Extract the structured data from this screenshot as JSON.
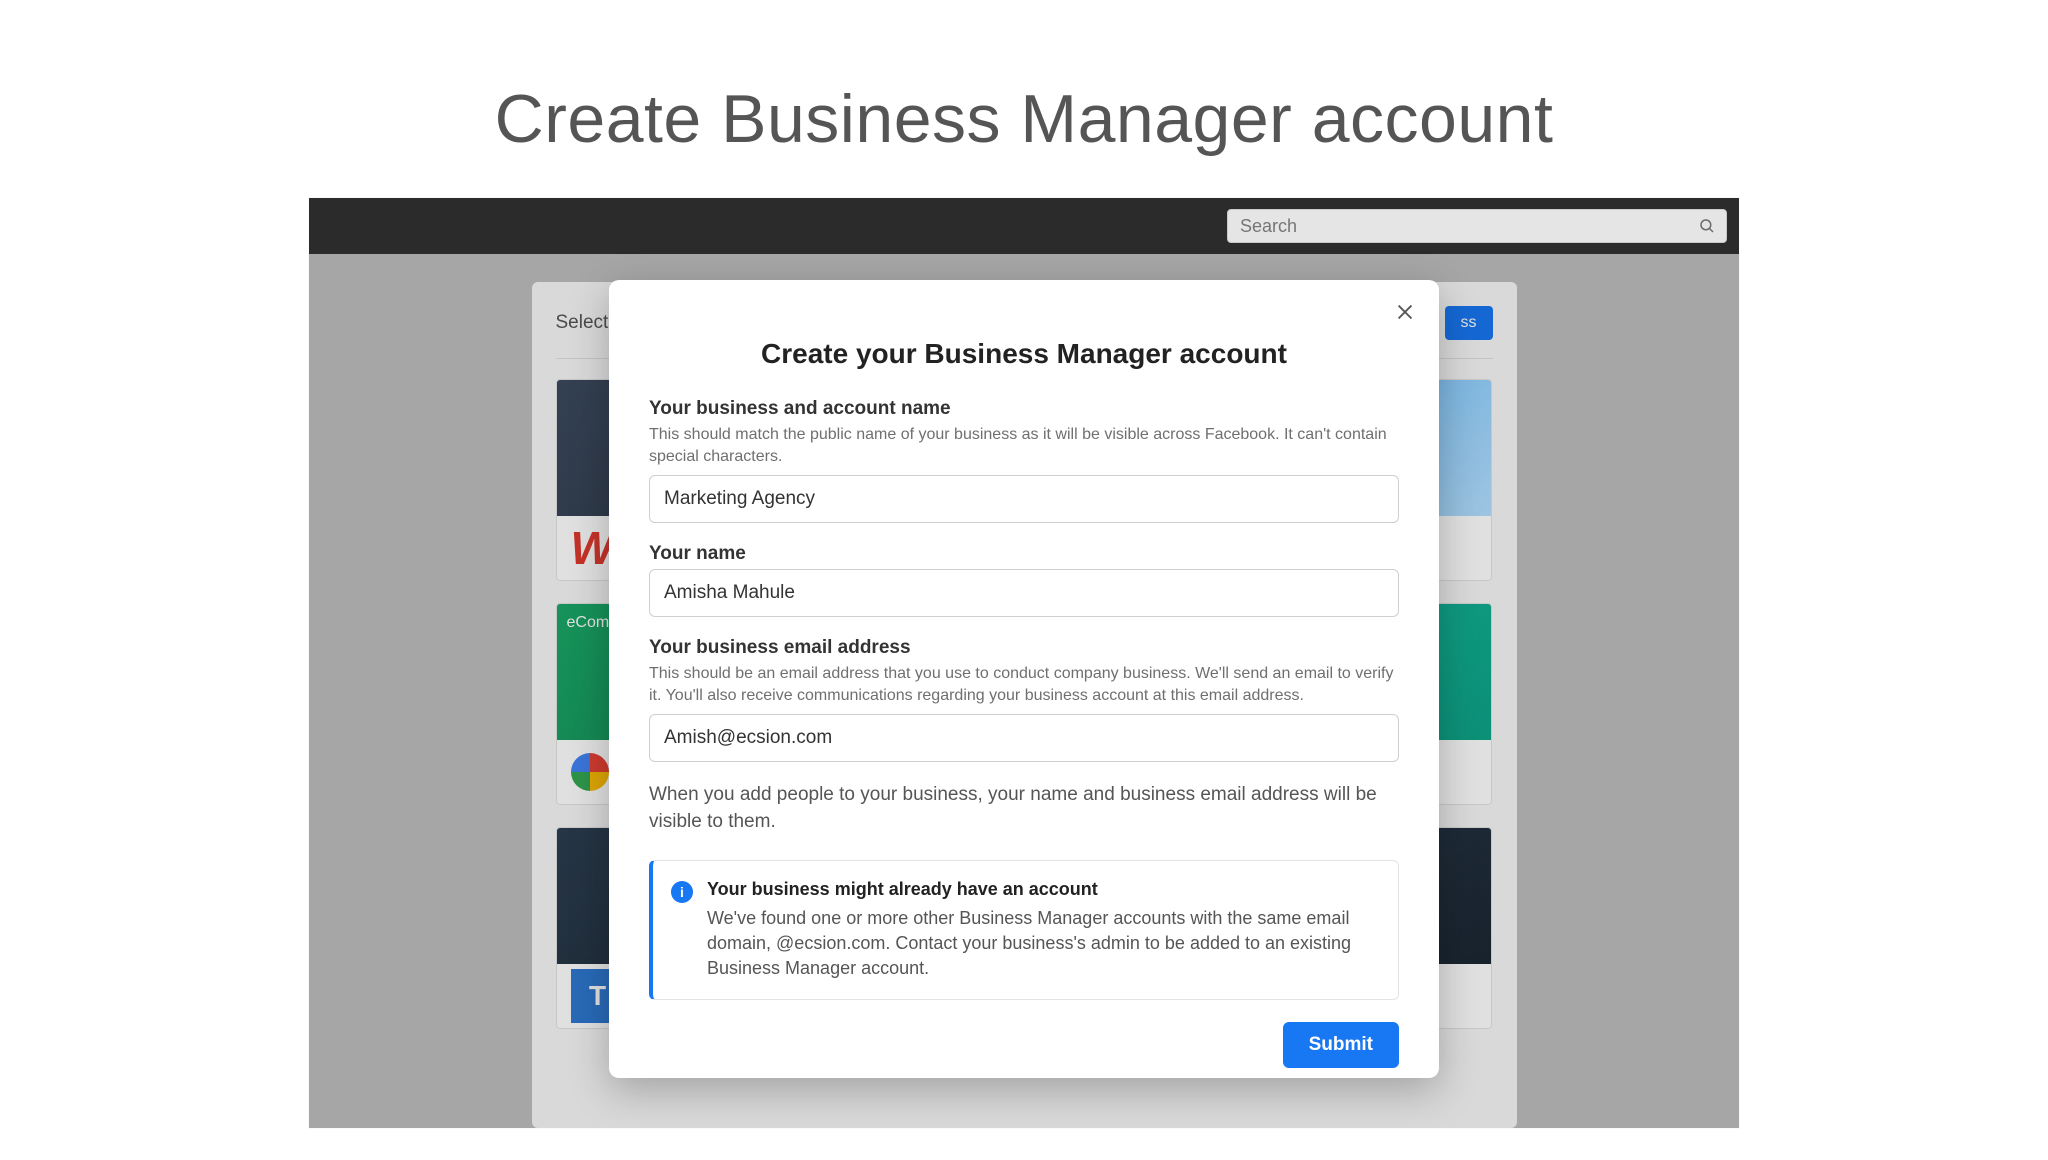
{
  "page": {
    "heading": "Create Business Manager account"
  },
  "topbar": {
    "search_placeholder": "Search"
  },
  "background_card": {
    "select_label": "Select",
    "cta_button_label": "ss",
    "ecommerce_label": "eComm"
  },
  "modal": {
    "title": "Create your Business Manager account",
    "business_name": {
      "label": "Your business and account name",
      "help": "This should match the public name of your business as it will be visible across Facebook. It can't contain special characters.",
      "value": "Marketing Agency"
    },
    "your_name": {
      "label": "Your name",
      "value": "Amisha Mahule"
    },
    "business_email": {
      "label": "Your business email address",
      "help": "This should be an email address that you use to conduct company business. We'll send an email to verify it. You'll also receive communications regarding your business account at this email address.",
      "value": "Amish@ecsion.com"
    },
    "visibility_note": "When you add people to your business, your name and business email address will be visible to them.",
    "callout": {
      "title": "Your business might already have an account",
      "body": "We've found one or more other Business Manager accounts with the same email domain, @ecsion.com. Contact your business's admin to be added to an existing Business Manager account."
    },
    "submit_label": "Submit"
  }
}
